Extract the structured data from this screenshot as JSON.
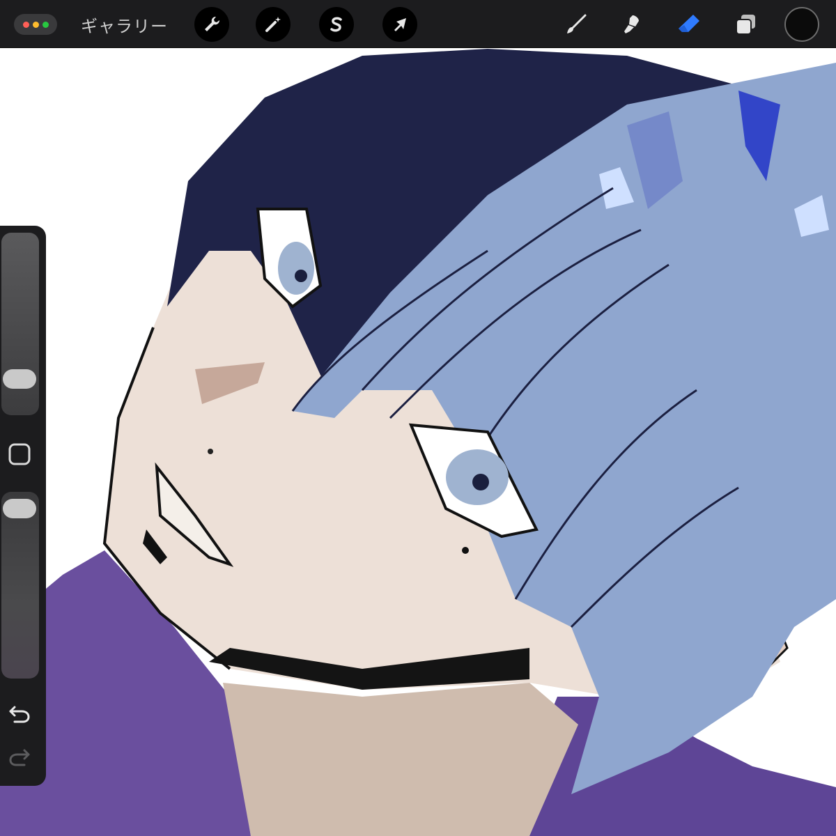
{
  "app": {
    "gallery_label": "ギャラリー"
  },
  "window_controls": {
    "colors": [
      "#ff5f57",
      "#febc2e",
      "#28c840"
    ]
  },
  "toolbar_left": [
    {
      "name": "actions",
      "icon": "wrench-icon"
    },
    {
      "name": "adjustments",
      "icon": "magic-wand-icon"
    },
    {
      "name": "selection",
      "icon": "selection-s-icon"
    },
    {
      "name": "transform",
      "icon": "arrow-cursor-icon"
    }
  ],
  "toolbar_right": [
    {
      "name": "brush",
      "icon": "brush-icon",
      "active": false
    },
    {
      "name": "smudge",
      "icon": "smudge-icon",
      "active": false
    },
    {
      "name": "eraser",
      "icon": "eraser-icon",
      "active": true
    },
    {
      "name": "layers",
      "icon": "layers-icon",
      "active": false
    }
  ],
  "color": {
    "current": "#0b0b0b",
    "accent": "#2f7bff"
  },
  "sidebar": {
    "brush_size_level": 0.33,
    "opacity_level": 1.0,
    "modify_button": "square-icon",
    "undo_icon": "undo-icon",
    "redo_icon": "redo-icon"
  },
  "artwork": {
    "palette": {
      "hair_dark": "#1f2348",
      "hair_light": "#8fa6cf",
      "skin": "#ede0d7",
      "shirt": "#6a4f9e",
      "line": "#111111"
    }
  }
}
